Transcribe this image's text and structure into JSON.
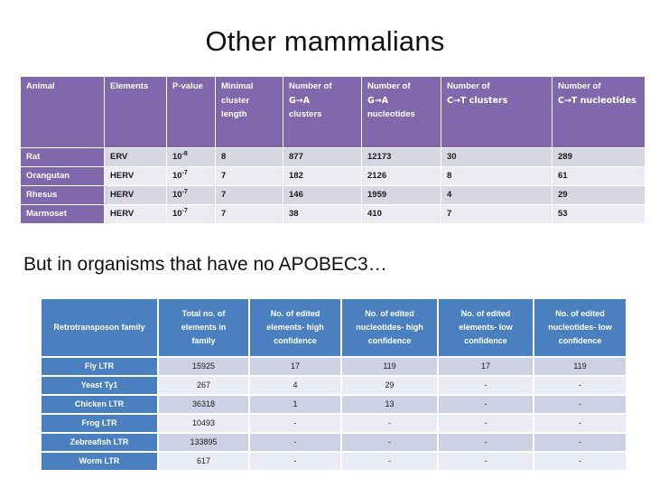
{
  "slide": {
    "title": "Other mammalians",
    "mid_text": "But in organisms that have no APOBEC3…"
  },
  "theme": {
    "purple": "#8167ab",
    "purple_row_odd": "#d6d7e2",
    "purple_row_even": "#ebebf1",
    "blue": "#4a80bf",
    "blue_row_odd": "#ccd2e3",
    "blue_row_even": "#e9ecf4",
    "text": "#111111",
    "header_text": "#ffffff"
  },
  "table1": {
    "headers": [
      {
        "lines": [
          "Animal"
        ]
      },
      {
        "lines": [
          "Elements"
        ]
      },
      {
        "lines": [
          "P-value"
        ]
      },
      {
        "lines": [
          "Minimal",
          "cluster",
          "length"
        ]
      },
      {
        "lines": [
          "Number of",
          "G→A",
          "clusters"
        ]
      },
      {
        "lines": [
          "Number of",
          "G→A",
          "nucleotides"
        ]
      },
      {
        "lines": [
          "Number of",
          "C→T clusters"
        ]
      },
      {
        "lines": [
          "Number of",
          "C→T nucleotides"
        ]
      }
    ],
    "rows": [
      {
        "animal": "Rat",
        "elements": "ERV",
        "p_base": "10",
        "p_exp": "-8",
        "min_cluster_length": "8",
        "ga_clusters": "877",
        "ga_nucleotides": "12173",
        "ct_clusters": "30",
        "ct_nucleotides": "289"
      },
      {
        "animal": "Orangutan",
        "elements": "HERV",
        "p_base": "10",
        "p_exp": "-7",
        "min_cluster_length": "7",
        "ga_clusters": "182",
        "ga_nucleotides": "2126",
        "ct_clusters": "8",
        "ct_nucleotides": "61"
      },
      {
        "animal": "Rhesus",
        "elements": "HERV",
        "p_base": "10",
        "p_exp": "-7",
        "min_cluster_length": "7",
        "ga_clusters": "146",
        "ga_nucleotides": "1959",
        "ct_clusters": "4",
        "ct_nucleotides": "29"
      },
      {
        "animal": "Marmoset",
        "elements": "HERV",
        "p_base": "10",
        "p_exp": "-7",
        "min_cluster_length": "7",
        "ga_clusters": "38",
        "ga_nucleotides": "410",
        "ct_clusters": "7",
        "ct_nucleotides": "53"
      }
    ]
  },
  "table2": {
    "headers": [
      {
        "lines": [
          "Retrotransposon family"
        ]
      },
      {
        "lines": [
          "Total no. of",
          "elements in",
          "family"
        ]
      },
      {
        "lines": [
          "No. of edited",
          "elements- high",
          "confidence"
        ]
      },
      {
        "lines": [
          "No. of edited",
          "nucleotides- high",
          "confidence"
        ]
      },
      {
        "lines": [
          "No. of edited",
          "elements- low",
          "confidence"
        ]
      },
      {
        "lines": [
          "No. of edited",
          "nucleotides- low",
          "confidence"
        ]
      }
    ],
    "rows": [
      {
        "family": "Fly LTR",
        "total_elements": "15925",
        "edited_elements_high": "17",
        "edited_nucleotides_high": "119",
        "edited_elements_low": "17",
        "edited_nucleotides_low": "119"
      },
      {
        "family": "Yeast Ty1",
        "total_elements": "267",
        "edited_elements_high": "4",
        "edited_nucleotides_high": "29",
        "edited_elements_low": "-",
        "edited_nucleotides_low": "-"
      },
      {
        "family": "Chicken LTR",
        "total_elements": "36318",
        "edited_elements_high": "1",
        "edited_nucleotides_high": "13",
        "edited_elements_low": "-",
        "edited_nucleotides_low": "-"
      },
      {
        "family": "Frog LTR",
        "total_elements": "10493",
        "edited_elements_high": "-",
        "edited_nucleotides_high": "-",
        "edited_elements_low": "-",
        "edited_nucleotides_low": "-"
      },
      {
        "family": "Zebreafish LTR",
        "total_elements": "133895",
        "edited_elements_high": "-",
        "edited_nucleotides_high": "-",
        "edited_elements_low": "-",
        "edited_nucleotides_low": "-"
      },
      {
        "family": "Worm LTR",
        "total_elements": "617",
        "edited_elements_high": "-",
        "edited_nucleotides_high": "-",
        "edited_elements_low": "-",
        "edited_nucleotides_low": "-"
      }
    ]
  }
}
